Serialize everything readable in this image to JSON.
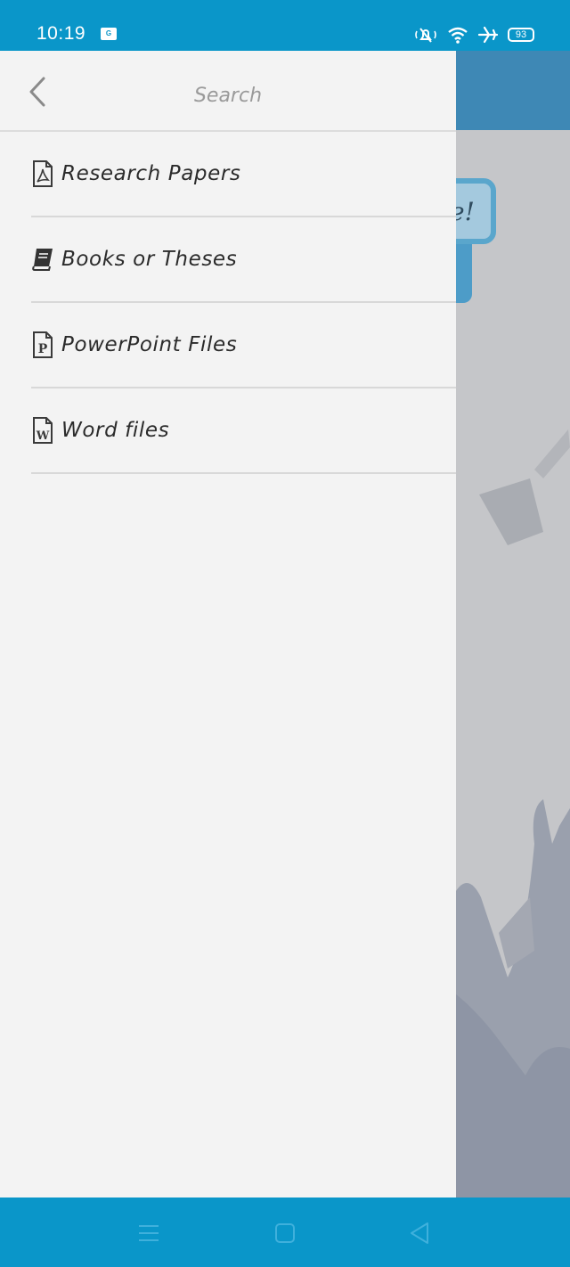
{
  "status_bar": {
    "time": "10:19",
    "sim_label": "G",
    "battery": "93",
    "icons": [
      "mute-icon",
      "wifi-icon",
      "airplane-icon",
      "battery-icon"
    ]
  },
  "background": {
    "bubble_text": "e!"
  },
  "drawer": {
    "title": "Search",
    "items": [
      {
        "label": "Research Papers",
        "icon": "pdf-file-icon"
      },
      {
        "label": "Books or Theses",
        "icon": "book-icon"
      },
      {
        "label": "PowerPoint Files",
        "icon": "powerpoint-file-icon"
      },
      {
        "label": "Word files",
        "icon": "word-file-icon"
      }
    ]
  },
  "nav_bar": {
    "buttons": [
      "menu-icon",
      "home-icon",
      "back-icon"
    ]
  },
  "colors": {
    "accent": "#0a96c9",
    "drawer_bg": "#f3f3f3",
    "header_blue": "#3e88b5"
  }
}
